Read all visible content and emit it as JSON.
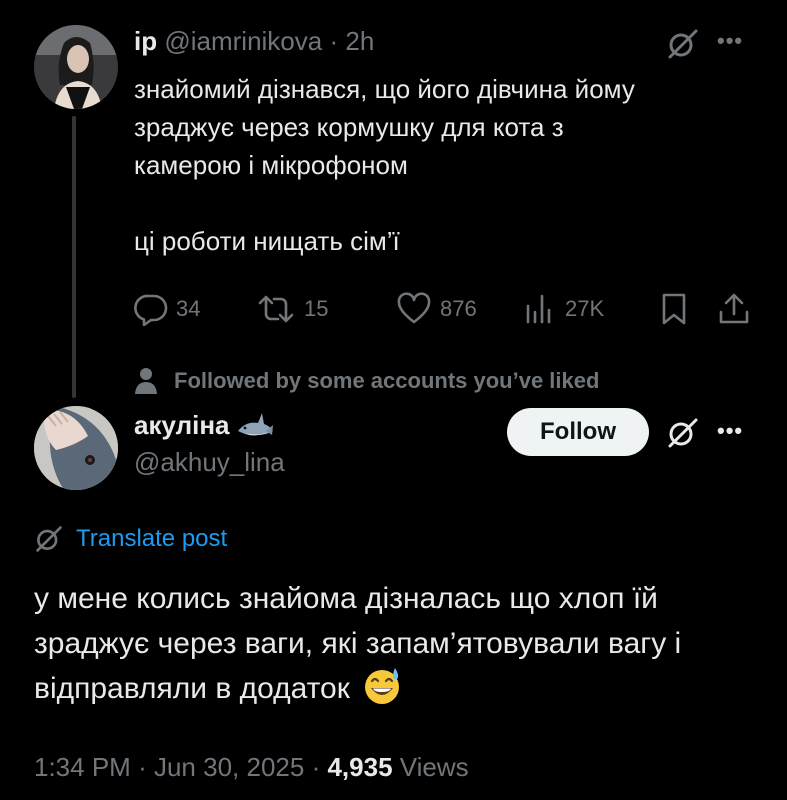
{
  "reply": {
    "author_name": "ip",
    "author_handle": "@iamrinikova",
    "separator": "·",
    "time": "2h",
    "lines": [
      "знайомий дізнався, що його дівчина йому",
      "зраджує через кормушку для кота з",
      "камерою і мікрофоном",
      "ці роботи нищать сім’ї"
    ],
    "stats": {
      "replies": "34",
      "reposts": "15",
      "likes": "876",
      "views": "27K"
    }
  },
  "social_context": "Followed by some accounts you’ve liked",
  "main_post": {
    "author_name": "акуліна",
    "author_handle": "@akhuy_lina",
    "follow_label": "Follow",
    "translate_label": "Translate post",
    "text": "у мене колись знайома дізналась що хлоп їй зраджує через ваги, які запам’ятовували вагу і відправляли в додаток",
    "time": "1:34 PM",
    "date": "Jun 30, 2025",
    "views_count": "4,935",
    "views_label": "Views",
    "separator": "·"
  },
  "icons": {
    "grok": "grok-icon",
    "more": "more-icon",
    "reply": "reply-icon",
    "repost": "repost-icon",
    "like": "heart-icon",
    "views": "views-icon",
    "bookmark": "bookmark-icon",
    "share": "share-icon",
    "person": "person-icon",
    "shark": "shark-emoji",
    "sweat": "grinning-sweat-emoji"
  },
  "colors": {
    "background": "#000000",
    "text": "#e7e9ea",
    "muted": "#71767b",
    "link": "#1d9bf0",
    "follow_bg": "#eff3f4"
  }
}
